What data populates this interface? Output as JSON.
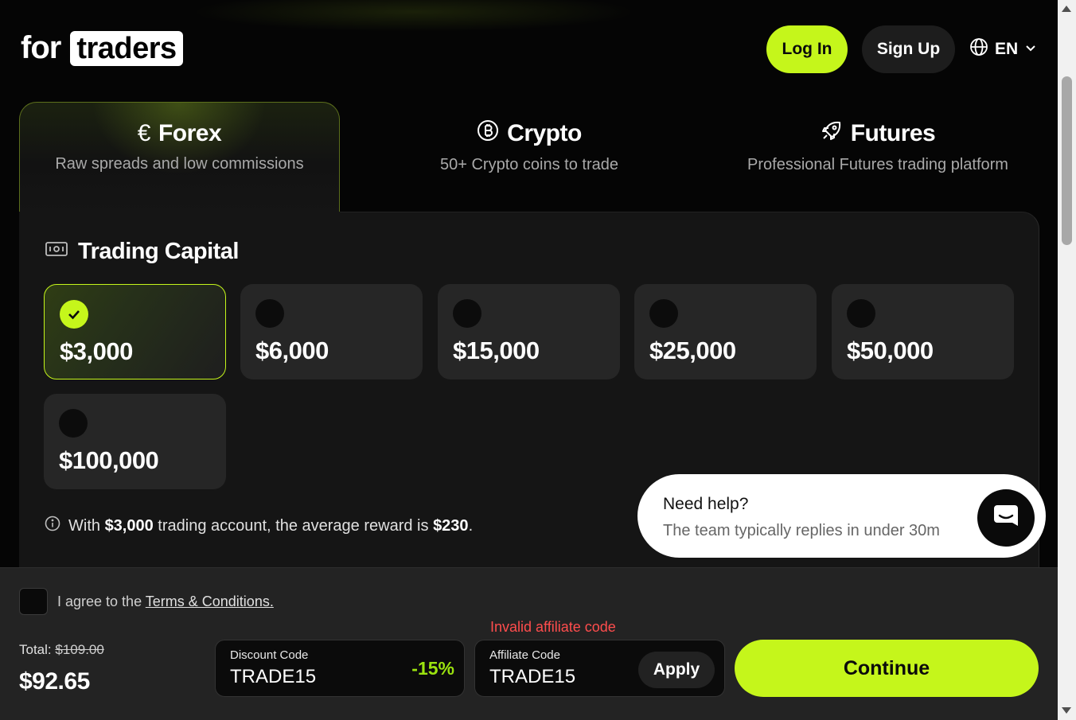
{
  "header": {
    "logo_prefix": "for",
    "logo_highlight": "traders",
    "login_label": "Log In",
    "signup_label": "Sign Up",
    "language": "EN"
  },
  "tabs": [
    {
      "title": "Forex",
      "subtitle": "Raw spreads and low commissions",
      "icon": "euro-icon",
      "active": true
    },
    {
      "title": "Crypto",
      "subtitle": "50+ Crypto coins to trade",
      "icon": "bitcoin-icon",
      "active": false
    },
    {
      "title": "Futures",
      "subtitle": "Professional Futures trading platform",
      "icon": "rocket-icon",
      "active": false
    }
  ],
  "trading_capital": {
    "title": "Trading Capital",
    "options": [
      {
        "amount": "$3,000",
        "selected": true
      },
      {
        "amount": "$6,000",
        "selected": false
      },
      {
        "amount": "$15,000",
        "selected": false
      },
      {
        "amount": "$25,000",
        "selected": false
      },
      {
        "amount": "$50,000",
        "selected": false
      },
      {
        "amount": "$100,000",
        "selected": false
      }
    ],
    "info_prefix": "With",
    "info_amount": "$3,000",
    "info_middle": "trading account, the average reward is",
    "info_reward": "$230",
    "info_suffix": "."
  },
  "help_widget": {
    "title": "Need help?",
    "subtitle": "The team typically replies in under 30m"
  },
  "checkout": {
    "agree_prefix": "I agree to the",
    "agree_link": "Terms & Conditions.",
    "total_label": "Total:",
    "total_original": "$109.00",
    "total_price": "$92.65",
    "discount_label": "Discount Code",
    "discount_value": "TRADE15",
    "discount_percent": "-15%",
    "affiliate_label": "Affiliate Code",
    "affiliate_value": "TRADE15",
    "apply_label": "Apply",
    "affiliate_error": "Invalid affiliate code",
    "continue_label": "Continue"
  },
  "colors": {
    "accent": "#c5f61b",
    "background": "#050505",
    "error": "#ff4d4d"
  }
}
